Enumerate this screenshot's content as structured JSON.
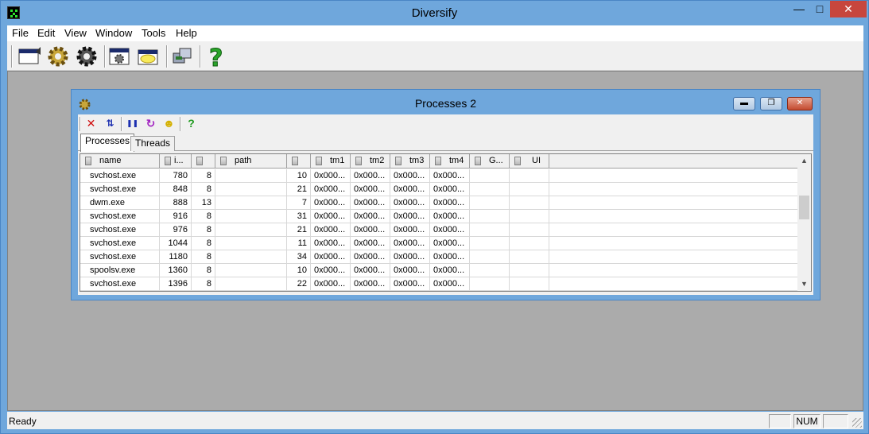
{
  "app": {
    "title": "Diversify"
  },
  "window_controls": {
    "minimize": "—",
    "maximize": "□",
    "close": "✕"
  },
  "menu": [
    "File",
    "Edit",
    "View",
    "Window",
    "Tools",
    "Help"
  ],
  "toolbar": {
    "icons": [
      "new-window-icon",
      "gear-icon",
      "gear-dark-icon",
      "window-gear-icon",
      "open-folder-icon",
      "network-icon",
      "help-icon"
    ]
  },
  "child": {
    "title": "Processes 2",
    "controls": {
      "minimize": "▬",
      "restore": "❐",
      "close": "✕"
    },
    "toolbar_icons": [
      "close-icon",
      "sort-icon",
      "pause-icon",
      "refresh-icon",
      "smiley-icon",
      "help-icon"
    ],
    "toolbar_glyphs": [
      "✕",
      "⇅",
      "❚❚",
      "↻",
      "☻",
      "?"
    ],
    "tabs": [
      "Processes",
      "Threads"
    ],
    "columns": [
      "name",
      "i...",
      "",
      "path",
      "",
      "tm1",
      "tm2",
      "tm3",
      "tm4",
      "G...",
      "UI"
    ],
    "rows": [
      [
        "svchost.exe",
        "780",
        "8",
        "",
        "10",
        "0x000...",
        "0x000...",
        "0x000...",
        "0x000...",
        "",
        ""
      ],
      [
        "svchost.exe",
        "848",
        "8",
        "",
        "21",
        "0x000...",
        "0x000...",
        "0x000...",
        "0x000...",
        "",
        ""
      ],
      [
        "dwm.exe",
        "888",
        "13",
        "",
        "7",
        "0x000...",
        "0x000...",
        "0x000...",
        "0x000...",
        "",
        ""
      ],
      [
        "svchost.exe",
        "916",
        "8",
        "",
        "31",
        "0x000...",
        "0x000...",
        "0x000...",
        "0x000...",
        "",
        ""
      ],
      [
        "svchost.exe",
        "976",
        "8",
        "",
        "21",
        "0x000...",
        "0x000...",
        "0x000...",
        "0x000...",
        "",
        ""
      ],
      [
        "svchost.exe",
        "1044",
        "8",
        "",
        "11",
        "0x000...",
        "0x000...",
        "0x000...",
        "0x000...",
        "",
        ""
      ],
      [
        "svchost.exe",
        "1180",
        "8",
        "",
        "34",
        "0x000...",
        "0x000...",
        "0x000...",
        "0x000...",
        "",
        ""
      ],
      [
        "spoolsv.exe",
        "1360",
        "8",
        "",
        "10",
        "0x000...",
        "0x000...",
        "0x000...",
        "0x000...",
        "",
        ""
      ],
      [
        "svchost.exe",
        "1396",
        "8",
        "",
        "22",
        "0x000...",
        "0x000...",
        "0x000...",
        "0x000...",
        "",
        ""
      ]
    ]
  },
  "status": {
    "text": "Ready",
    "num": "NUM"
  },
  "colors": {
    "frame": "#6fa7dc",
    "client": "#ababab",
    "close": "#c7463d"
  }
}
